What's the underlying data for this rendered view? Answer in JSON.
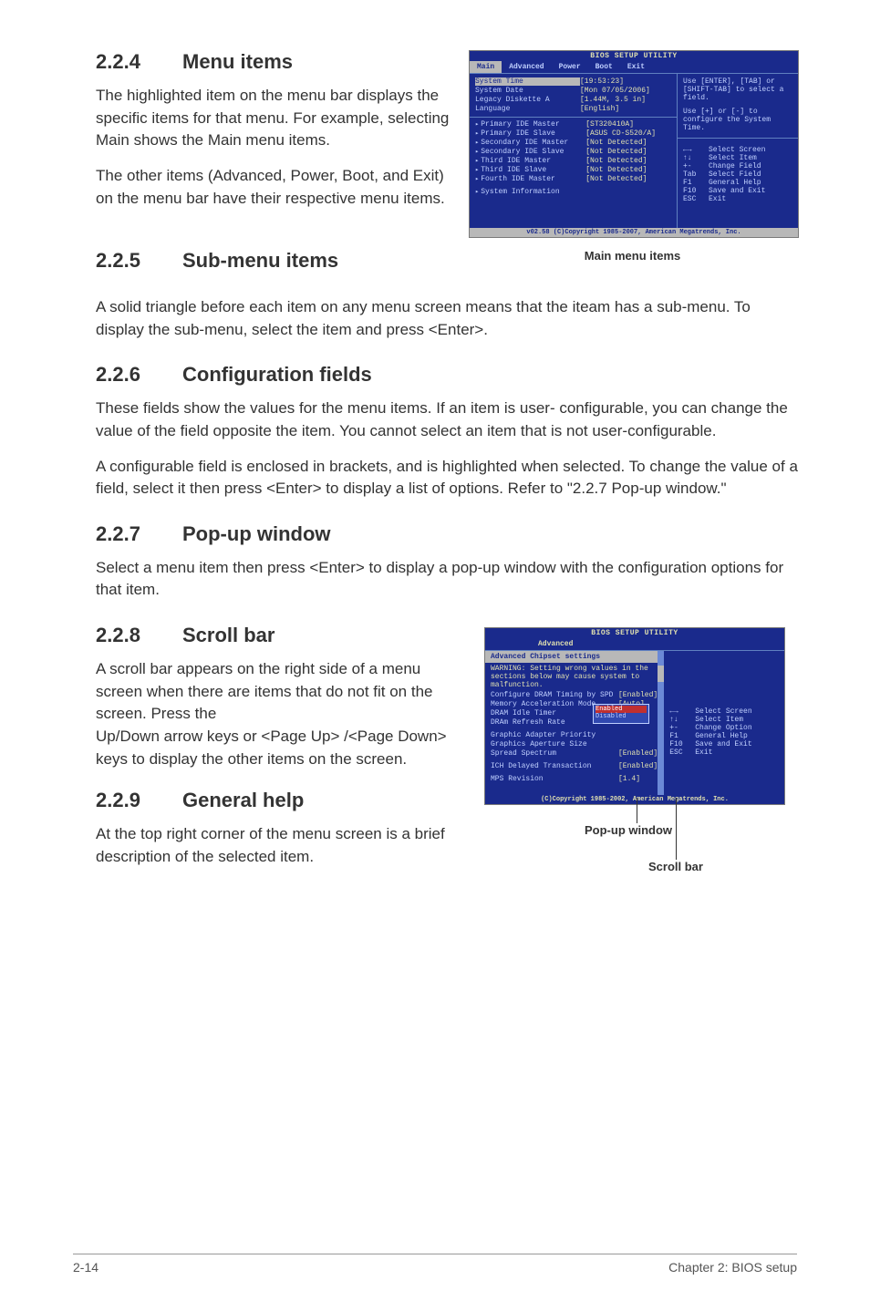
{
  "s224": {
    "num": "2.2.4",
    "title": "Menu items",
    "p1": "The highlighted item on the menu bar  displays the specific items for that menu. For example, selecting Main shows the Main menu items.",
    "p2": "The other items (Advanced, Power, Boot, and Exit) on the menu bar have their respective menu items."
  },
  "s225": {
    "num": "2.2.5",
    "title": "Sub-menu items",
    "p1": "A solid triangle before each item on any menu screen means that the iteam has a sub-menu. To display the sub-menu, select the item and press <Enter>."
  },
  "s226": {
    "num": "2.2.6",
    "title": "Configuration fields",
    "p1": "These fields show the values for the menu items. If an item is user- configurable, you can change the value of the field opposite the item. You cannot select an item that is not user-configurable.",
    "p2": "A configurable field is enclosed in brackets, and is highlighted when selected. To change the value of a field, select it then press <Enter> to display a list of options. Refer to \"2.2.7 Pop-up window.\""
  },
  "s227": {
    "num": "2.2.7",
    "title": "Pop-up window",
    "p1": "Select a menu item then press <Enter> to display a pop-up window with the configuration options for that item."
  },
  "s228": {
    "num": "2.2.8",
    "title": "Scroll bar",
    "p1": "A scroll bar appears on the right side of a menu screen when there are items that do not fit on the screen. Press the",
    "p2": "Up/Down arrow keys or <Page Up> /<Page Down> keys to display the other items on the screen."
  },
  "s229": {
    "num": "2.2.9",
    "title": "General help",
    "p1": "At the top right corner of the menu screen is a brief description of the selected item."
  },
  "bios1": {
    "title": "BIOS SETUP UTILITY",
    "tabs": {
      "main": "Main",
      "advanced": "Advanced",
      "power": "Power",
      "boot": "Boot",
      "exit": "Exit"
    },
    "rows": {
      "time_l": "System Time",
      "time_v": "[19:53:23]",
      "date_l": "System Date",
      "date_v": "[Mon 07/05/2006]",
      "legacy_l": "Legacy Diskette A",
      "legacy_v": "[1.44M, 3.5 in]",
      "lang_l": "Language",
      "lang_v": "[English]",
      "pim_l": "Primary IDE Master",
      "pim_v": "[ST320410A]",
      "pis_l": "Primary IDE Slave",
      "pis_v": "[ASUS CD-S520/A]",
      "sim_l": "Secondary IDE Master",
      "sim_v": "[Not Detected]",
      "sis_l": "Secondary IDE Slave",
      "sis_v": "[Not Detected]",
      "tim_l": "Third IDE Master",
      "tim_v": "[Not Detected]",
      "tis_l": "Third IDE Slave",
      "tis_v": "[Not Detected]",
      "fim_l": "Fourth IDE Master",
      "fim_v": "[Not Detected]",
      "sysinfo_l": "System Information"
    },
    "help1": "Use [ENTER], [TAB] or [SHIFT-TAB] to select a field.",
    "help2": "Use [+] or [-] to configure the System Time.",
    "keys": {
      "k1l": "←→",
      "k1r": "Select Screen",
      "k2l": "↑↓",
      "k2r": "Select Item",
      "k3l": "+-",
      "k3r": "Change Field",
      "k4l": "Tab",
      "k4r": "Select Field",
      "k5l": "F1",
      "k5r": "General Help",
      "k6l": "F10",
      "k6r": "Save and Exit",
      "k7l": "ESC",
      "k7r": "Exit"
    },
    "foot": "v02.58 (C)Copyright 1985-2007, American Megatrends, Inc.",
    "caption": "Main menu items"
  },
  "bios2": {
    "title": "BIOS SETUP UTILITY",
    "tab": "Advanced",
    "header": "Advanced Chipset settings",
    "warn": "WARNING: Setting wrong values in the sections below may cause system to malfunction.",
    "rows": {
      "cdt_l": "Configure DRAM Timing by SPD",
      "cdt_v": "[Enabled]",
      "mam_l": "Memory Acceleration Mode",
      "mam_v": "[Auto]",
      "dit_l": "DRAM Idle Timer",
      "dit_v": "",
      "drr_l": "DRAm Refresh Rate",
      "drr_v": "",
      "gap_l": "Graphic Adapter Priority",
      "gap_v": "",
      "gas_l": "Graphics Aperture Size",
      "gas_v": "",
      "ss_l": "Spread Spectrum",
      "ss_v": "[Enabled]",
      "idt_l": "ICH Delayed Transaction",
      "idt_v": "[Enabled]",
      "mps_l": "MPS Revision",
      "mps_v": "[1.4]"
    },
    "popup_opt1": "Enabled",
    "popup_opt2": "Disabled",
    "keys": {
      "k1l": "←→",
      "k1r": "Select Screen",
      "k2l": "↑↓",
      "k2r": "Select Item",
      "k3l": "+-",
      "k3r": "Change Option",
      "k4l": "F1",
      "k4r": "General Help",
      "k5l": "F10",
      "k5r": "Save and Exit",
      "k6l": "ESC",
      "k6r": "Exit"
    },
    "foot": "(C)Copyright 1985-2002, American Megatrends, Inc.",
    "popup_label": "Pop-up window",
    "scroll_label": "Scroll bar"
  },
  "footer": {
    "page": "2-14",
    "chapter": "Chapter 2: BIOS setup"
  }
}
